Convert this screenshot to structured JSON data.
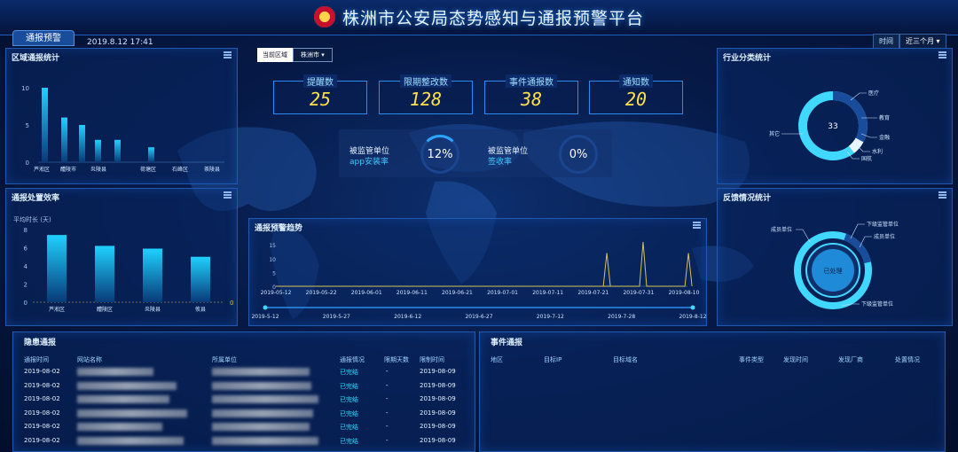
{
  "header": {
    "title": "株洲市公安局态势感知与通报预警平台",
    "tab": "通报预警",
    "datetime": "2019.8.12 17:41"
  },
  "time_filter": {
    "label": "时间",
    "value": "近三个月 ▾"
  },
  "zone_filter": {
    "label": "当前区域",
    "value": "株洲市 ▾"
  },
  "region_stats": {
    "title": "区域通报统计",
    "chart_data": {
      "type": "bar",
      "categories": [
        "芦淞区",
        "醴陵市",
        "炎陵县",
        "荷塘区",
        "石峰区",
        "茶陵县"
      ],
      "values": [
        10,
        6,
        5,
        3,
        3,
        2
      ],
      "ylim": [
        0,
        10
      ],
      "yticks": [
        "10",
        "5",
        "0"
      ]
    }
  },
  "efficiency": {
    "title": "通报处置效率",
    "ylabel": "平均时长 (天)",
    "chart_data": {
      "type": "bar",
      "categories": [
        "芦淞区",
        "醴陵区",
        "炎陵县",
        "攸县"
      ],
      "values": [
        7.4,
        6.2,
        5.9,
        5.0
      ],
      "ylim": [
        0,
        8
      ],
      "yticks": [
        "8",
        "6",
        "4",
        "2",
        "0"
      ],
      "right_tick": "0"
    }
  },
  "stats": [
    {
      "label": "提醒数",
      "value": "25"
    },
    {
      "label": "限期整改数",
      "value": "128"
    },
    {
      "label": "事件通报数",
      "value": "38"
    },
    {
      "label": "通知数",
      "value": "20"
    }
  ],
  "rates": {
    "a_line1": "被监管单位",
    "a_line2": "app安装率",
    "a_value": "12%",
    "b_line1": "被监管单位",
    "b_line2": "签收率",
    "b_value": "0%"
  },
  "trend": {
    "title": "通报预警趋势",
    "chart_data": {
      "type": "line",
      "x": [
        "2019-05-12",
        "2019-05-22",
        "2019-06-01",
        "2019-06-11",
        "2019-06-21",
        "2019-07-01",
        "2019-07-11",
        "2019-07-21",
        "2019-07-31",
        "2019-08-10"
      ],
      "yticks": [
        "15",
        "10",
        "5",
        "0"
      ],
      "peaks": [
        {
          "x": "2019-07-24",
          "y": 12
        },
        {
          "x": "2019-08-01",
          "y": 16
        },
        {
          "x": "2019-08-11",
          "y": 12
        }
      ]
    },
    "slider_labels": [
      "2019-5-12",
      "2019-5-27",
      "2019-6-12",
      "2019-6-27",
      "2019-7-12",
      "2019-7-28",
      "2019-8-12"
    ]
  },
  "industry": {
    "title": "行业分类统计",
    "center": "33",
    "labels": [
      "医疗",
      "教育",
      "金融",
      "水利",
      "国航",
      "其它"
    ]
  },
  "feedback": {
    "title": "反馈情况统计",
    "center": "已处理",
    "labels": [
      "成员单位",
      "下级监管单位",
      "成员单位",
      "下级监管单位"
    ]
  },
  "hidden_report": {
    "title": "隐患通报",
    "headers": [
      "通报时间",
      "网站名称",
      "所属单位",
      "通报情况",
      "限期天数",
      "限制时间"
    ],
    "rows": [
      {
        "time": "2019-08-02",
        "status": "已完结",
        "days": "-",
        "limit": "2019-08-09"
      },
      {
        "time": "2019-08-02",
        "status": "已完结",
        "days": "-",
        "limit": "2019-08-09"
      },
      {
        "time": "2019-08-02",
        "status": "已完结",
        "days": "-",
        "limit": "2019-08-09"
      },
      {
        "time": "2019-08-02",
        "status": "已完结",
        "days": "-",
        "limit": "2019-08-09"
      },
      {
        "time": "2019-08-02",
        "status": "已完结",
        "days": "-",
        "limit": "2019-08-09"
      },
      {
        "time": "2019-08-02",
        "status": "已完结",
        "days": "-",
        "limit": "2019-08-09"
      }
    ]
  },
  "event_report": {
    "title": "事件通报",
    "headers": [
      "地区",
      "目标IP",
      "目标域名",
      "事件类型",
      "发现时间",
      "发现厂商",
      "处置情况"
    ]
  },
  "colors": {
    "accent": "#1fd1ff",
    "stat_value": "#ffe04a",
    "line": "#d8c35a"
  }
}
